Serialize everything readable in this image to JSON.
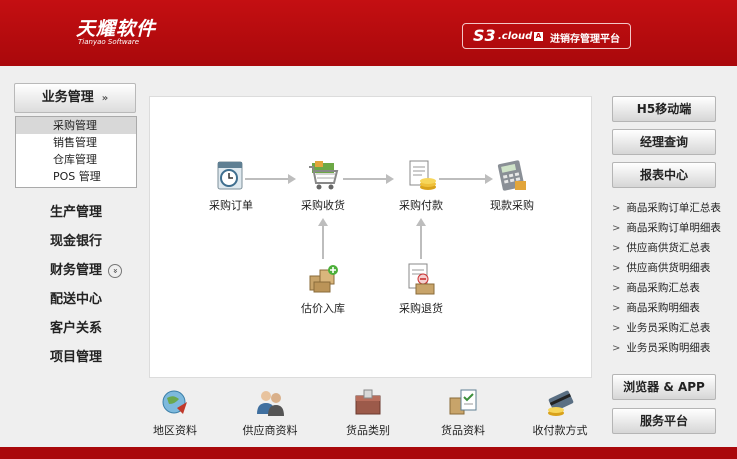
{
  "header": {
    "brand_cn": "天耀软件",
    "brand_en": "Tianyao Software",
    "product_s3": "S3",
    "product_cloud": ".cloud",
    "product_cloud_icon": "A",
    "product_platform": "进销存管理平台"
  },
  "leftnav": {
    "header_label": "业务管理",
    "header_icon": "»",
    "subitems": [
      "采购管理",
      "销售管理",
      "仓库管理",
      "POS 管理"
    ],
    "items": [
      {
        "label": "生产管理",
        "icon": ""
      },
      {
        "label": "现金银行",
        "icon": ""
      },
      {
        "label": "财务管理",
        "icon": "»"
      },
      {
        "label": "配送中心",
        "icon": ""
      },
      {
        "label": "客户关系",
        "icon": ""
      },
      {
        "label": "项目管理",
        "icon": ""
      }
    ]
  },
  "flow": {
    "nodes": [
      {
        "label": "采购订单",
        "icon": "calendar-clock-icon"
      },
      {
        "label": "采购收货",
        "icon": "shopping-cart-icon"
      },
      {
        "label": "采购付款",
        "icon": "document-coins-icon"
      },
      {
        "label": "现款采购",
        "icon": "calculator-icon"
      },
      {
        "label": "估价入库",
        "icon": "boxes-add-icon"
      },
      {
        "label": "采购退货",
        "icon": "document-return-icon"
      }
    ]
  },
  "bottom": {
    "items": [
      {
        "label": "地区资料",
        "icon": "globe-icon"
      },
      {
        "label": "供应商资料",
        "icon": "people-icon"
      },
      {
        "label": "货品类别",
        "icon": "box-category-icon"
      },
      {
        "label": "货品资料",
        "icon": "product-checklist-icon"
      },
      {
        "label": "收付款方式",
        "icon": "card-payment-icon"
      }
    ]
  },
  "right": {
    "buttons_top": [
      "H5移动端",
      "经理查询",
      "报表中心"
    ],
    "links": [
      "商品采购订单汇总表",
      "商品采购订单明细表",
      "供应商供货汇总表",
      "供应商供货明细表",
      "商品采购汇总表",
      "商品采购明细表",
      "业务员采购汇总表",
      "业务员采购明细表"
    ],
    "link_marker": ">",
    "buttons_bottom": [
      "浏览器 & APP",
      "服务平台"
    ]
  },
  "colors": {
    "brand_red": "#b3090c",
    "panel_bg": "#efefef"
  }
}
